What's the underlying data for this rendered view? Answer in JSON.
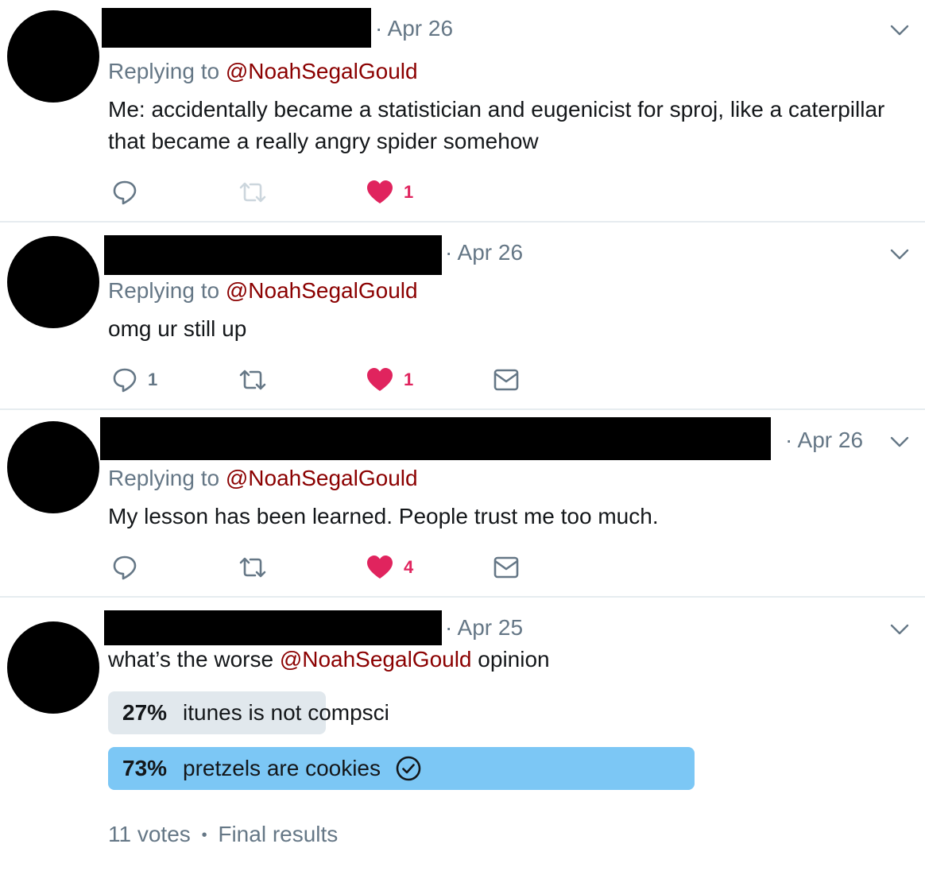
{
  "tweets": [
    {
      "date": "· Apr 26",
      "replying_prefix": "Replying to",
      "mention": "@NoahSegalGould",
      "text_line1": "Me: accidentally became a statistician and eugenicist for sproj, like a caterpillar",
      "text_line2": "that became a really angry spider somehow",
      "actions": {
        "reply_count": "",
        "retweet_count": "",
        "like_count": "1",
        "liked": true,
        "retweet_enabled": false
      }
    },
    {
      "date": "· Apr 26",
      "replying_prefix": "Replying to",
      "mention": "@NoahSegalGould",
      "text_line1": "omg ur still up",
      "actions": {
        "reply_count": "1",
        "retweet_count": "",
        "like_count": "1",
        "liked": true,
        "retweet_enabled": true
      }
    },
    {
      "date": "· Apr 26",
      "replying_prefix": "Replying to",
      "mention": "@NoahSegalGould",
      "text_line1": "My lesson has been learned. People trust me too much.",
      "actions": {
        "reply_count": "",
        "retweet_count": "",
        "like_count": "4",
        "liked": true,
        "retweet_enabled": true
      }
    },
    {
      "date": "· Apr 25",
      "text_before": "what’s the worse ",
      "mention": "@NoahSegalGould",
      "text_after": " opinion",
      "poll": {
        "options": [
          {
            "percent": "27%",
            "label": "itunes is not compsci",
            "winner": false,
            "share": 0.27
          },
          {
            "percent": "73%",
            "label": "pretzels are cookies",
            "winner": true,
            "share": 0.73
          }
        ],
        "votes": "11 votes",
        "separator": "•",
        "status": "Final results"
      }
    }
  ],
  "colors": {
    "mention": "#8b0000",
    "secondary_text": "#657786",
    "like": "#e0245e",
    "poll_winner": "#7cc7f5",
    "poll_other": "#e1e8ed",
    "divider": "#e6ecf0"
  },
  "icons": [
    "reply-icon",
    "retweet-icon",
    "heart-icon",
    "envelope-icon",
    "chevron-down-icon",
    "check-circle-icon"
  ]
}
